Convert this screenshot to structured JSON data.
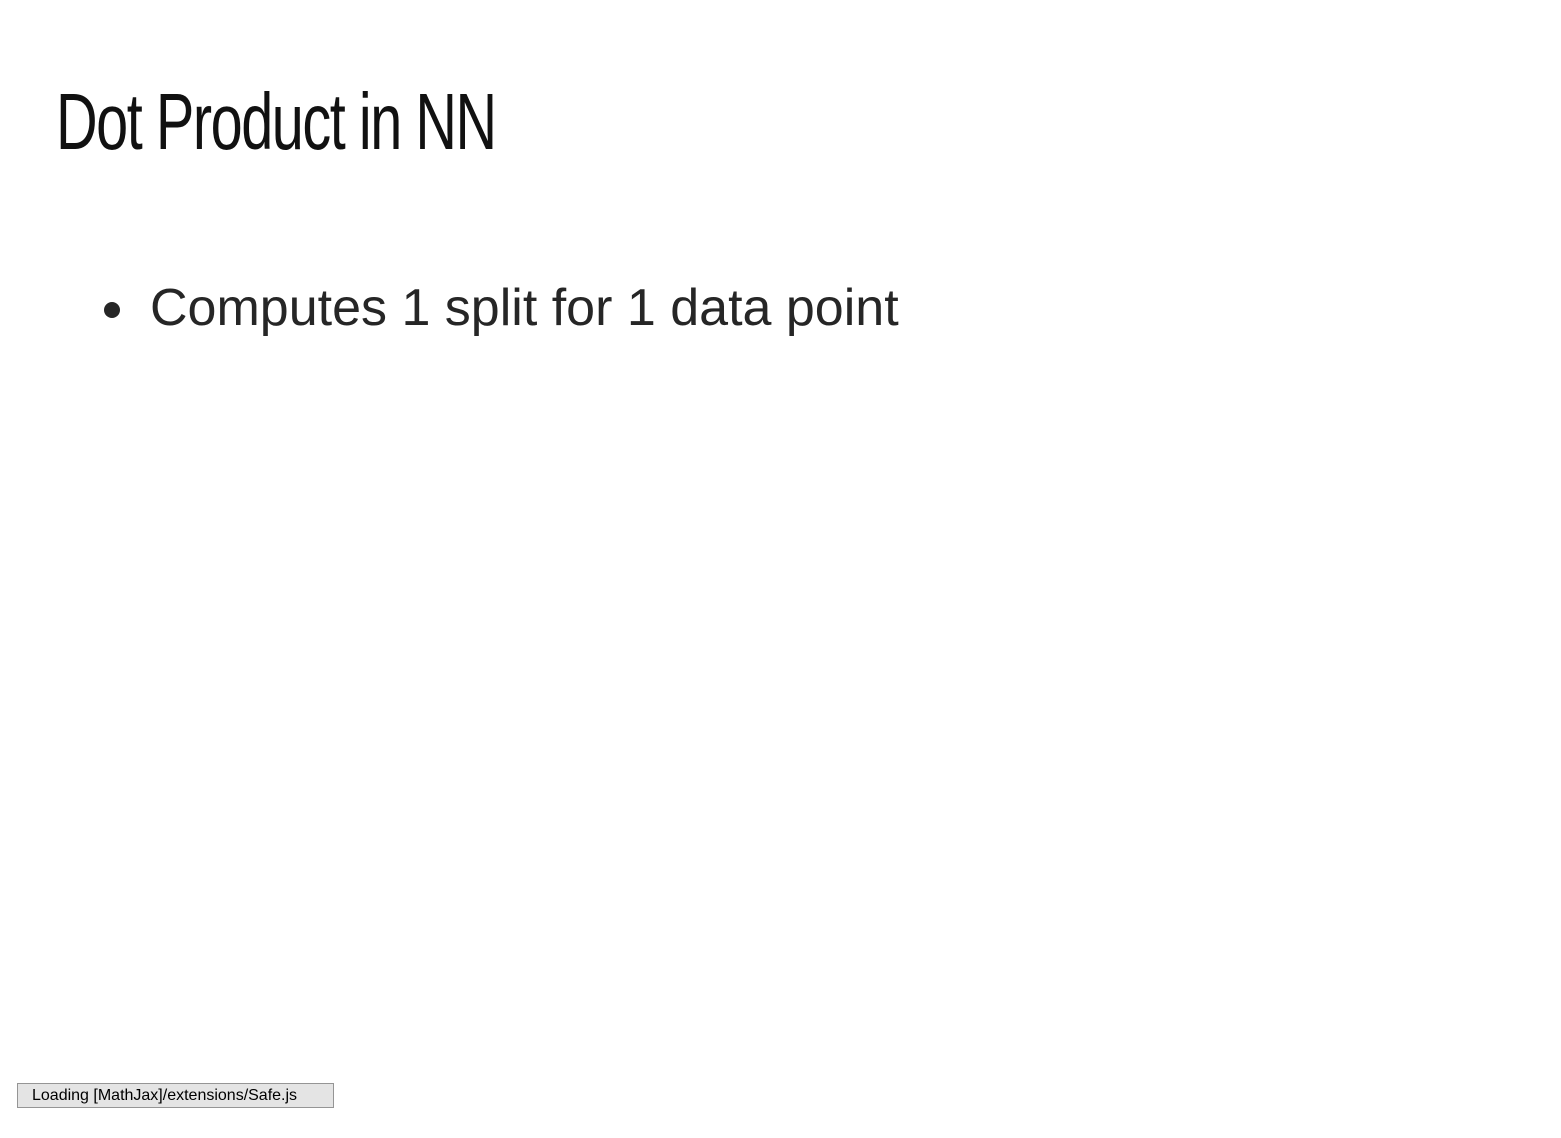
{
  "slide": {
    "title": "Dot Product in NN",
    "bullets": [
      "Computes 1 split for 1 data point"
    ]
  },
  "status": {
    "message": "Loading [MathJax]/extensions/Safe.js"
  }
}
